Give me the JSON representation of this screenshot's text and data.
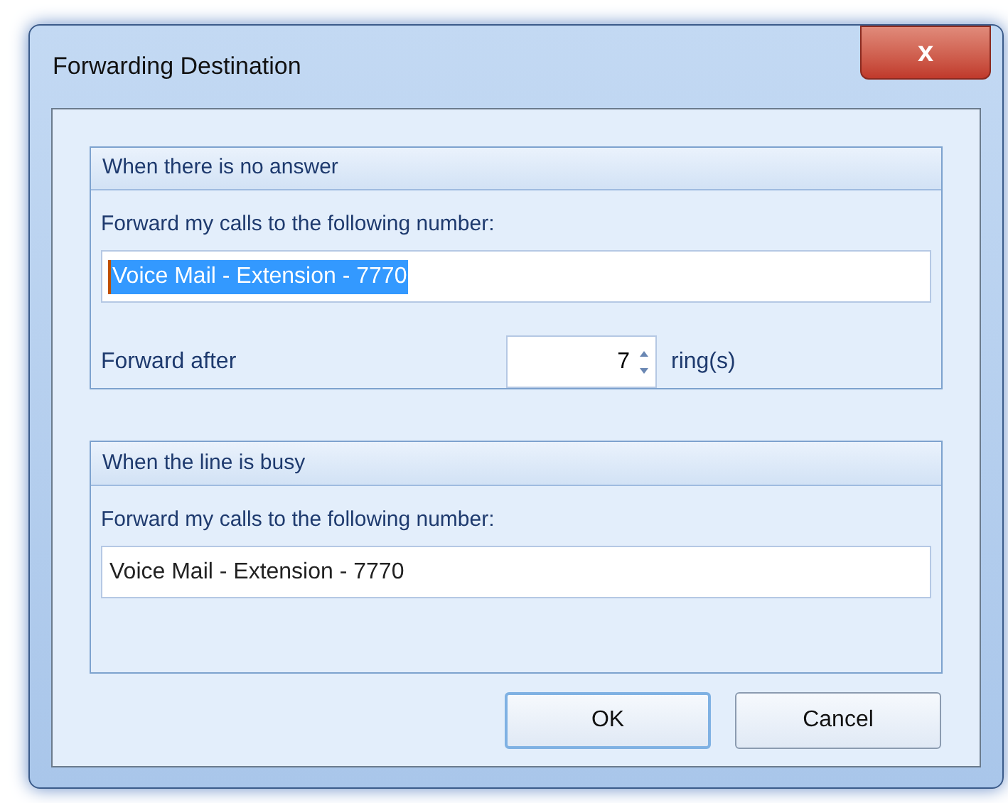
{
  "window": {
    "title": "Forwarding Destination",
    "close_label": "x"
  },
  "groups": [
    {
      "title": "When there is no answer",
      "label": "Forward my calls to the following number:",
      "field": {
        "value": "Voice Mail - Extension - 7770",
        "selected": true
      },
      "rings": {
        "label": "Forward after",
        "value": "7",
        "unit": "ring(s)"
      }
    },
    {
      "title": "When the line is busy",
      "label": "Forward my calls to the following number:",
      "field": {
        "value": "Voice Mail - Extension - 7770",
        "selected": false
      }
    }
  ],
  "buttons": [
    {
      "label": "OK",
      "default": true
    },
    {
      "label": "Cancel",
      "default": false
    }
  ]
}
